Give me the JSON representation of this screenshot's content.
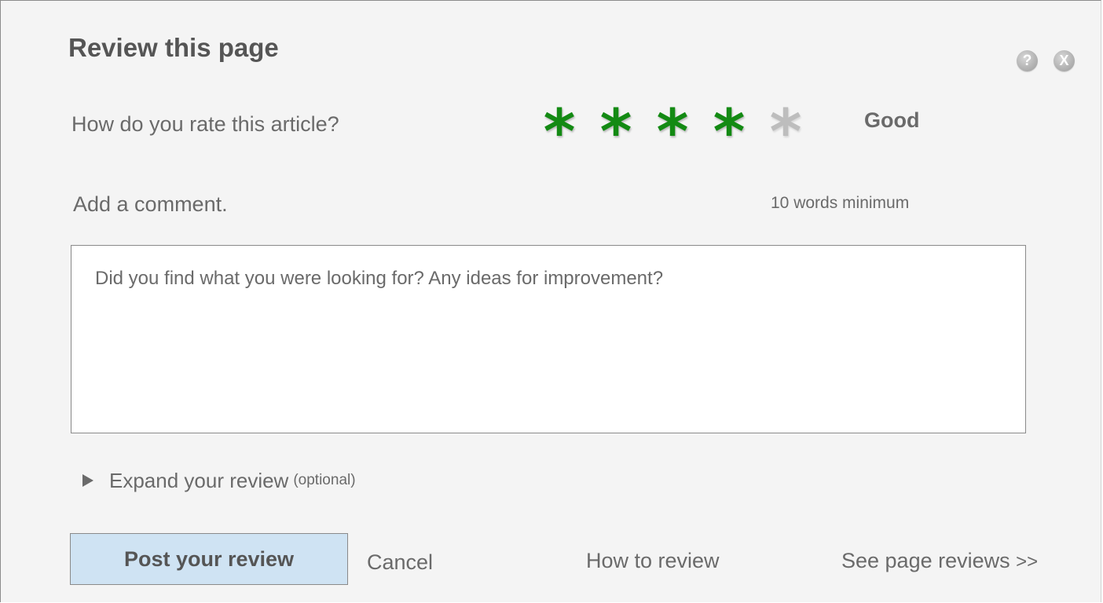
{
  "dialog": {
    "title": "Review this page",
    "help_icon": {
      "name": "help-icon",
      "glyph": "?"
    },
    "close_icon": {
      "name": "close-icon",
      "glyph": "X"
    }
  },
  "rating": {
    "question": "How do you rate this article?",
    "value": 4,
    "max": 5,
    "star_glyph": "*",
    "label": "Good",
    "colors": {
      "active": "#138a13",
      "inactive": "#bdbdbd"
    }
  },
  "comment": {
    "label": "Add a comment.",
    "min_words": "10 words minimum",
    "placeholder": "Did you find what you were looking for? Any ideas for improvement?",
    "value": ""
  },
  "expand": {
    "icon": "triangle-right-icon",
    "label": "Expand your review",
    "optional": "(optional)"
  },
  "actions": {
    "post_label": "Post your review",
    "post_color": "#cfe3f3",
    "cancel_label": "Cancel",
    "how_label": "How to review",
    "see_label": "See page reviews",
    "see_suffix": ">>"
  }
}
